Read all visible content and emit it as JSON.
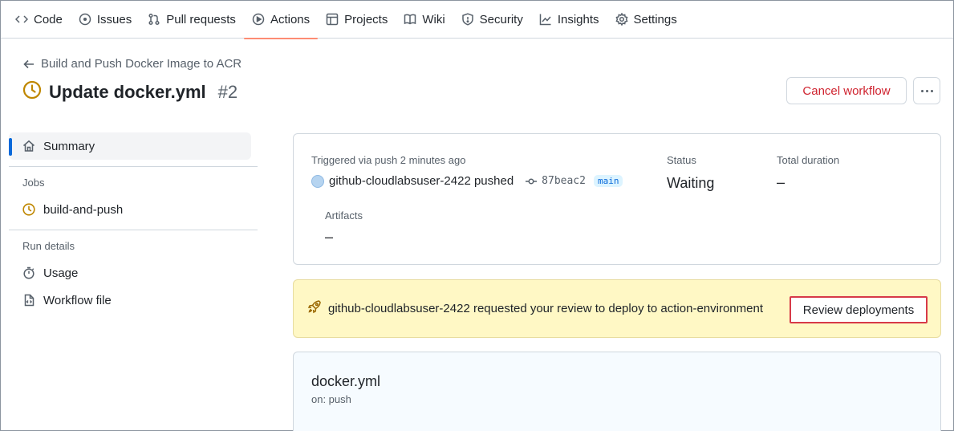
{
  "nav": {
    "tabs": [
      {
        "label": "Code",
        "icon": "code-icon"
      },
      {
        "label": "Issues",
        "icon": "issue-icon"
      },
      {
        "label": "Pull requests",
        "icon": "pull-request-icon"
      },
      {
        "label": "Actions",
        "icon": "play-icon",
        "active": true
      },
      {
        "label": "Projects",
        "icon": "table-icon"
      },
      {
        "label": "Wiki",
        "icon": "book-icon"
      },
      {
        "label": "Security",
        "icon": "shield-icon"
      },
      {
        "label": "Insights",
        "icon": "graph-icon"
      },
      {
        "label": "Settings",
        "icon": "gear-icon"
      }
    ]
  },
  "header": {
    "back_label": "Build and Push Docker Image to ACR",
    "title": "Update docker.yml",
    "run_number": "#2",
    "cancel_label": "Cancel workflow"
  },
  "sidebar": {
    "summary_label": "Summary",
    "jobs_heading": "Jobs",
    "job_label": "build-and-push",
    "run_details_heading": "Run details",
    "usage_label": "Usage",
    "workflow_file_label": "Workflow file"
  },
  "summary": {
    "triggered": "Triggered via push 2 minutes ago",
    "pusher": "github-cloudlabsuser-2422 pushed",
    "commit": "87beac2",
    "branch": "main",
    "status_label": "Status",
    "status_value": "Waiting",
    "duration_label": "Total duration",
    "duration_value": "–",
    "artifacts_label": "Artifacts",
    "artifacts_value": "–"
  },
  "review": {
    "message": "github-cloudlabsuser-2422 requested your review to deploy to action-environment",
    "button_label": "Review deployments"
  },
  "workflow": {
    "name": "docker.yml",
    "on": "on: push"
  },
  "colors": {
    "accent_underline": "#fd8c73",
    "danger": "#cf222e",
    "waiting_icon": "#bf8700",
    "banner_bg": "#fff8c5",
    "review_outline": "#d73a49"
  }
}
